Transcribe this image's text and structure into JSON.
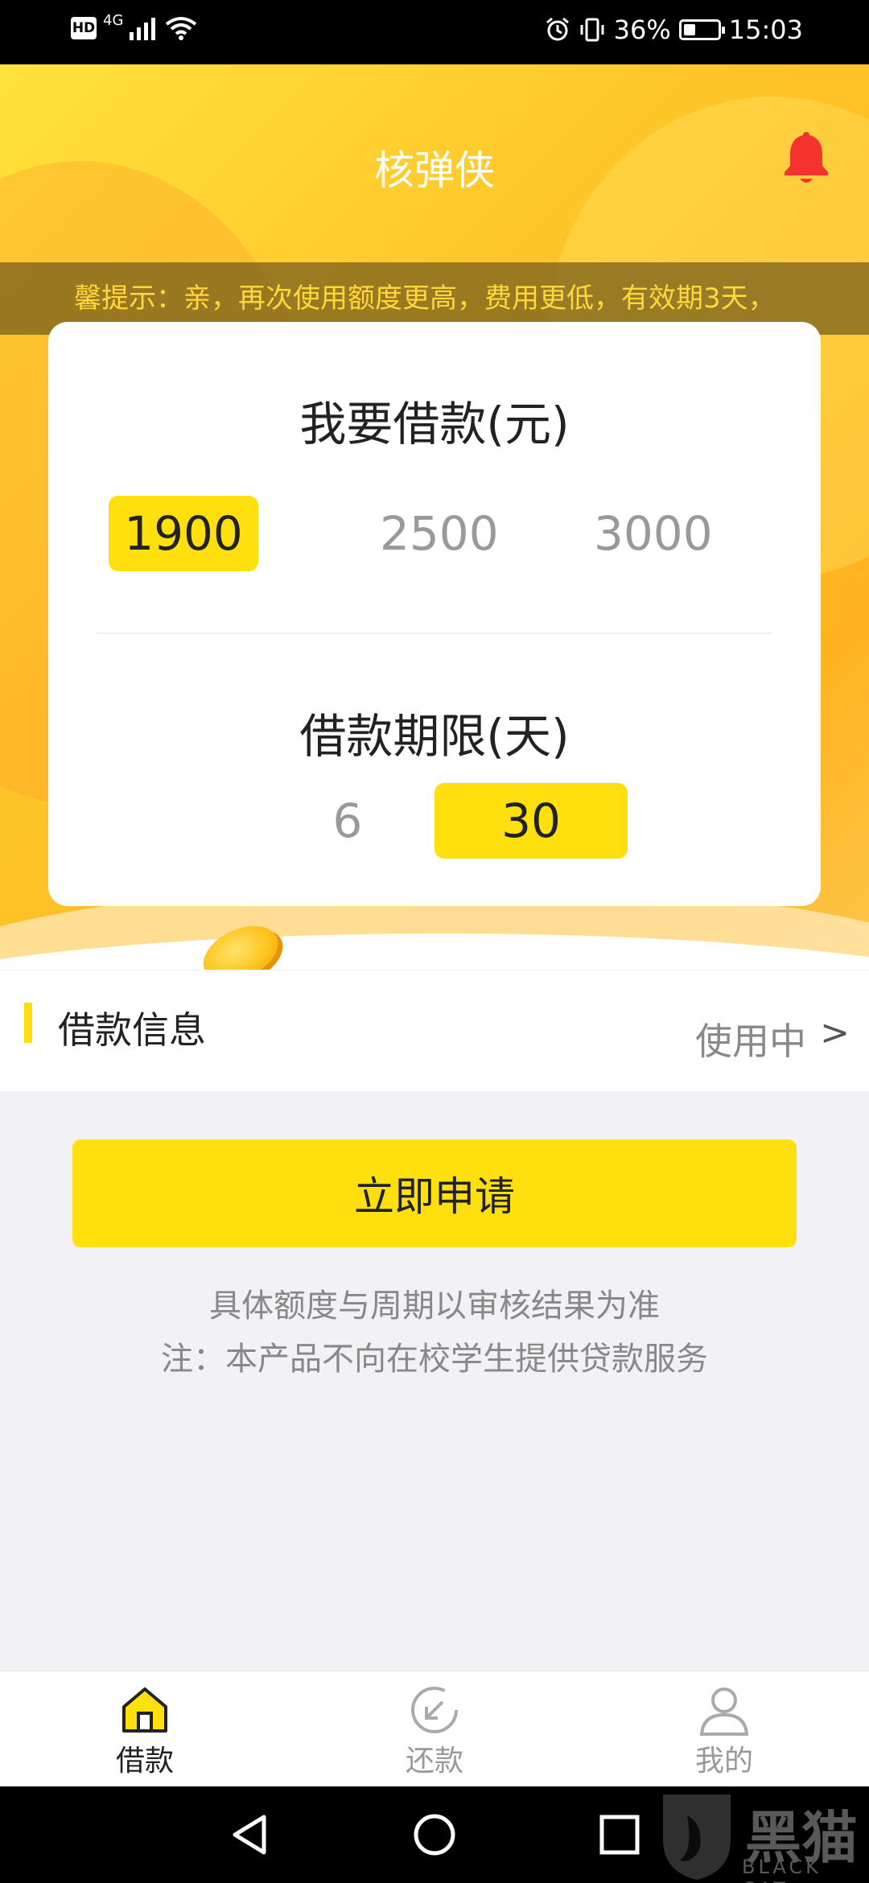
{
  "status_bar": {
    "hd": "HD",
    "network": "4G",
    "battery_percent": "36%",
    "battery_level": 0.36,
    "time": "15:03"
  },
  "header": {
    "title": "核弹侠",
    "notice": "馨提示：亲，再次使用额度更高，费用更低，有效期3天，",
    "bell_color": "#f5332e"
  },
  "loan_card": {
    "amount_title": "我要借款(元)",
    "amount_options": [
      "1900",
      "2500",
      "3000"
    ],
    "amount_selected": "1900",
    "term_title": "借款期限(天)",
    "term_options": [
      "6",
      "30"
    ],
    "term_selected": "30"
  },
  "info_row": {
    "label": "借款信息",
    "status": "使用中",
    "chevron": ">"
  },
  "apply": {
    "button_label": "立即申请",
    "note1": "具体额度与周期以审核结果为准",
    "note2": "注：本产品不向在校学生提供贷款服务"
  },
  "bottom_nav": {
    "items": [
      {
        "label": "借款",
        "icon": "home-icon",
        "active": true
      },
      {
        "label": "还款",
        "icon": "repay-icon",
        "active": false
      },
      {
        "label": "我的",
        "icon": "user-icon",
        "active": false
      }
    ]
  },
  "watermark": {
    "text": "黑猫",
    "sub": "BLACK CAT"
  },
  "colors": {
    "accent": "#ffe00e",
    "hero_start": "#ffe23a",
    "hero_end": "#ffb21f",
    "notice_text": "#ffd83a"
  }
}
